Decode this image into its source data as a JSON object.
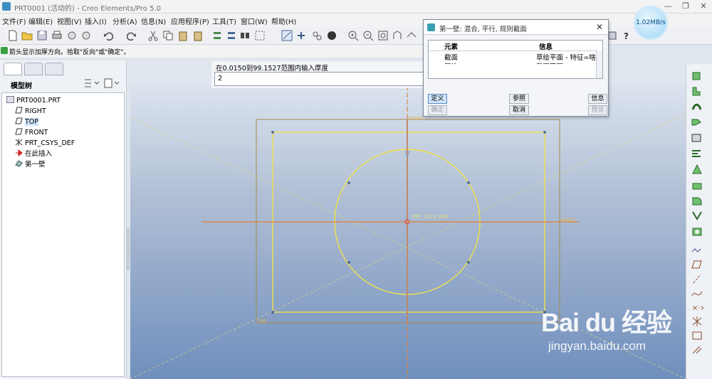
{
  "window": {
    "title": "PRT0001 (活动的) - Creo Elements/Pro 5.0"
  },
  "menu": [
    "文件(F)",
    "编辑(E)",
    "视图(V)",
    "插入(I)",
    "分析(A)",
    "信息(N)",
    "应用程序(P)",
    "工具(T)",
    "窗口(W)",
    "帮助(H)"
  ],
  "message": "箭头显示加厚方向。拾取\"反向\"或\"确定\"。",
  "speed_badge": "1.02MB/s",
  "left_panel": {
    "label": "模型树",
    "tree": [
      "PRT0001.PRT",
      "RIGHT",
      "TOP",
      "FRONT",
      "PRT_CSYS_DEF",
      "在此插入",
      "第一壁"
    ]
  },
  "input_bar": {
    "prompt": "在0.0150到99.1527范围内输入厚度",
    "value": "2"
  },
  "dialog": {
    "title": "第一壁: 混合, 平行, 规则截面",
    "col_element": "元素",
    "col_info": "信息",
    "rows": [
      {
        "element": "截面",
        "info": "草绘平面 - 特征=啥"
      },
      {
        "element": "属性",
        "info": "截面平面"
      }
    ],
    "buttons": {
      "define": "定义",
      "reference": "参照",
      "info": "信息",
      "ok": "确定",
      "cancel": "取消",
      "preview": "预览"
    }
  },
  "canvas_labels": {
    "right": "RIGHT",
    "front": "FRONT",
    "top": "TOP",
    "csys": "PRT_CSYS_DEF"
  },
  "watermark": {
    "brand": "Bai du 经验",
    "site": "jingyan.baidu.com"
  },
  "colors": {
    "sketch": "#f0e14a",
    "datum": "#d88a4a",
    "canvas_bottom": "#6f8fbd"
  }
}
